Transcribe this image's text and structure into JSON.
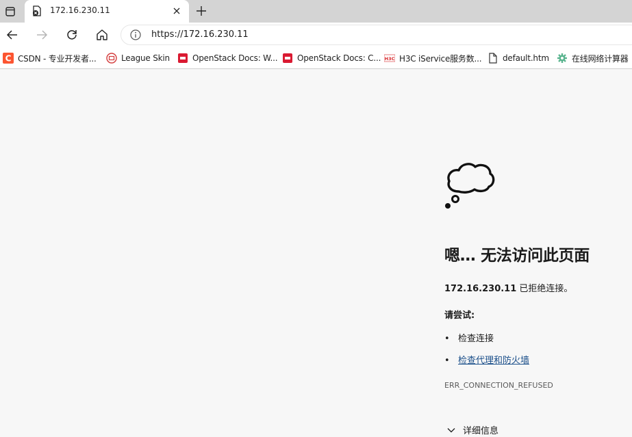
{
  "tab": {
    "title": "172.16.230.11",
    "favicon": "broken-page-icon",
    "close_icon": "close-icon"
  },
  "tab_actions_icon": "tab-actions-icon",
  "new_tab_icon": "plus-icon",
  "toolbar": {
    "back_icon": "back-arrow-icon",
    "forward_icon": "forward-arrow-icon",
    "refresh_icon": "refresh-icon",
    "home_icon": "home-icon",
    "site_info_icon": "info-icon",
    "url": "https://172.16.230.11"
  },
  "bookmarks": [
    {
      "label": "CSDN - 专业开发者...",
      "icon": "csdn-icon",
      "color": "#fc5531"
    },
    {
      "label": "League Skin",
      "icon": "league-skin-icon",
      "color": "#d33b3b"
    },
    {
      "label": "OpenStack Docs: W...",
      "icon": "openstack-icon",
      "color": "#da1a32"
    },
    {
      "label": "OpenStack Docs: C...",
      "icon": "openstack-icon",
      "color": "#da1a32"
    },
    {
      "label": "H3C iService服务数...",
      "icon": "h3c-icon",
      "color": "#d8262a"
    },
    {
      "label": "default.htm",
      "icon": "document-icon",
      "color": "#333333"
    },
    {
      "label": "在线网络计算器",
      "icon": "gear-icon",
      "color": "#5ab48f"
    }
  ],
  "error": {
    "icon": "thought-cloud-icon",
    "headline": "嗯… 无法访问此页面",
    "host": "172.16.230.11",
    "refused_text": " 已拒绝连接。",
    "try_label": "请尝试:",
    "suggestions": [
      {
        "text": "检查连接",
        "link": false
      },
      {
        "text": "检查代理和防火墙",
        "link": true
      }
    ],
    "code": "ERR_CONNECTION_REFUSED",
    "details_label": "详细信息",
    "details_icon": "chevron-down-icon"
  }
}
